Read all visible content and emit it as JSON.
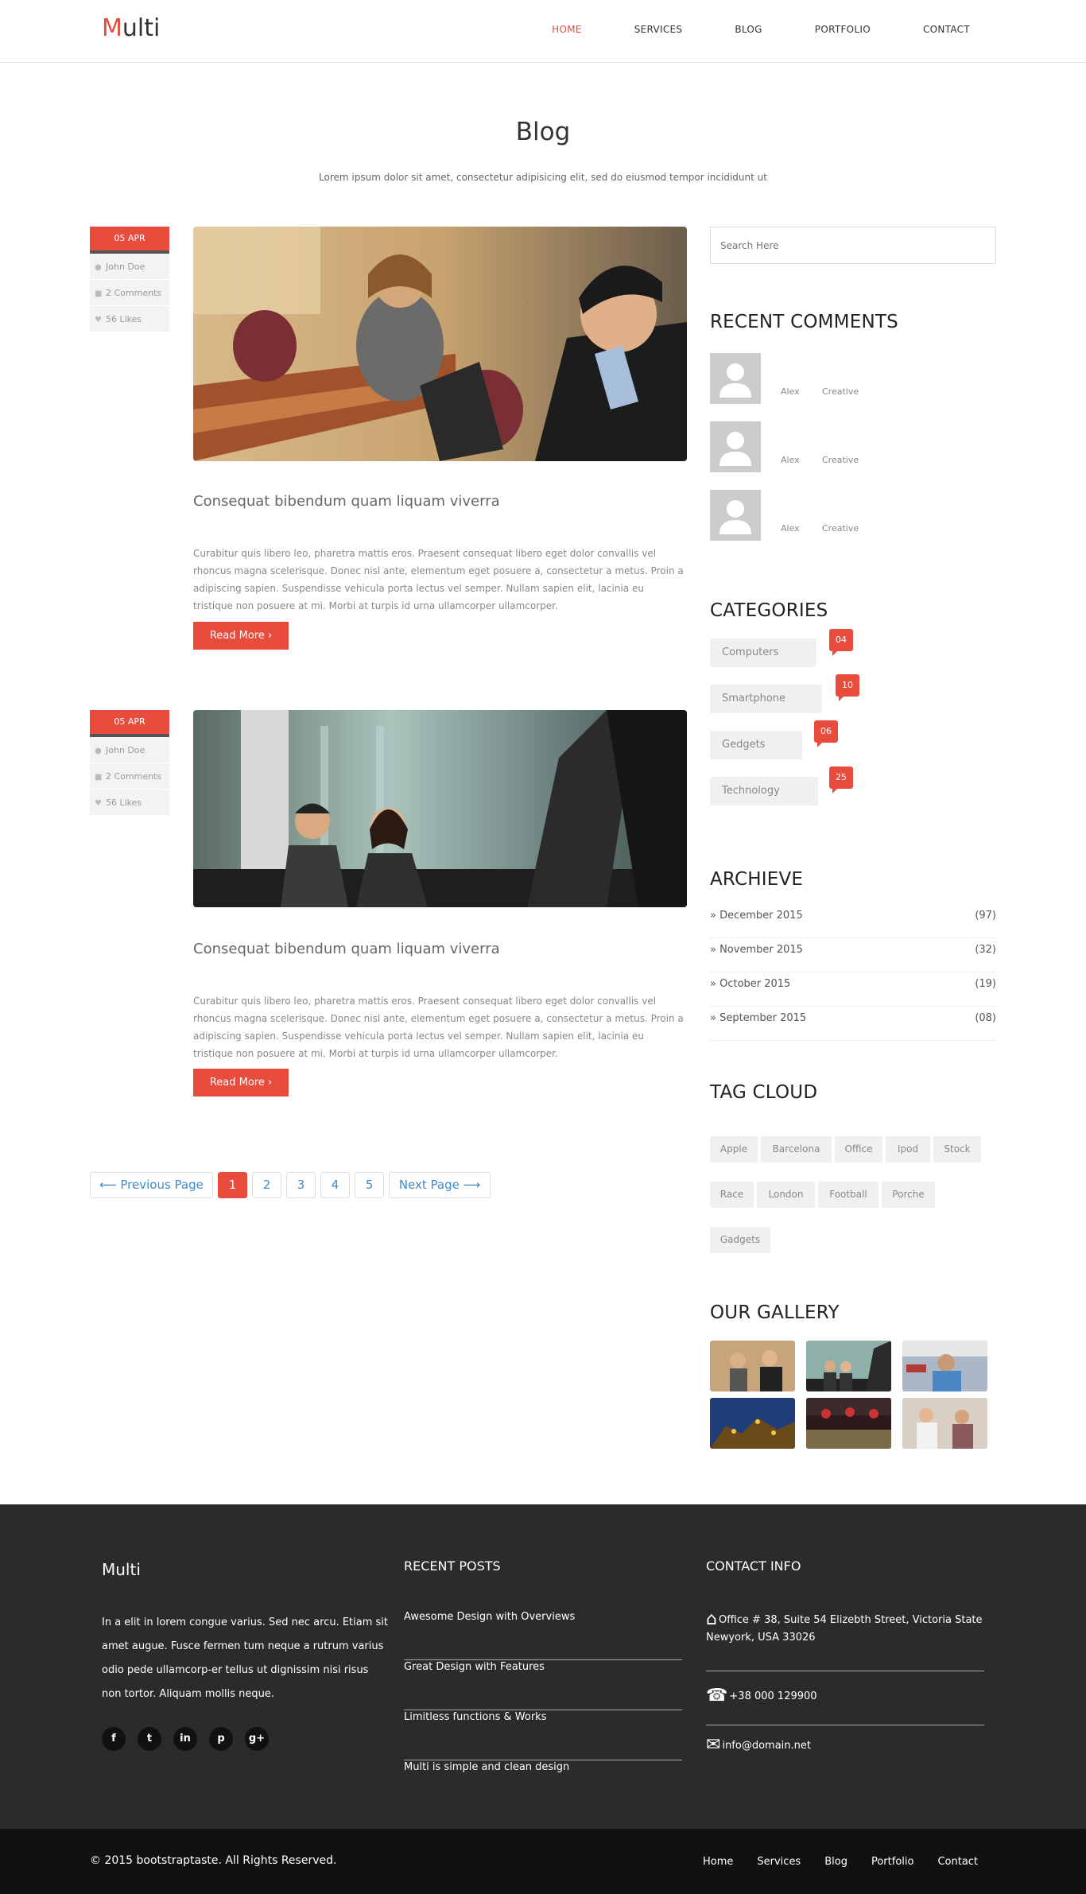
{
  "brand": {
    "first_letter": "M",
    "rest": "ulti"
  },
  "nav": [
    {
      "label": "HOME",
      "active": true
    },
    {
      "label": "SERVICES"
    },
    {
      "label": "BLOG"
    },
    {
      "label": "PORTFOLIO"
    },
    {
      "label": "CONTACT"
    }
  ],
  "page": {
    "title": "Blog",
    "subtitle": "Lorem ipsum dolor sit amet, consectetur adipisicing elit, sed do eiusmod tempor incididunt ut"
  },
  "posts": [
    {
      "date": "05 APR",
      "author": "John Doe",
      "comments": "2 Comments",
      "likes": "56 Likes",
      "title": "Consequat bibendum quam liquam viverra",
      "body": "Curabitur quis libero leo, pharetra mattis eros. Praesent consequat libero eget dolor convallis vel rhoncus magna scelerisque. Donec nisl ante, elementum eget posuere a, consectetur a metus. Proin a adipiscing sapien. Suspendisse vehicula porta lectus vel semper. Nullam sapien elit, lacinia eu tristique non posuere at mi. Morbi at turpis id urna ullamcorper ullamcorper.",
      "read_more": "Read More ›"
    },
    {
      "date": "05 APR",
      "author": "John Doe",
      "comments": "2 Comments",
      "likes": "56 Likes",
      "title": "Consequat bibendum quam liquam viverra",
      "body": "Curabitur quis libero leo, pharetra mattis eros. Praesent consequat libero eget dolor convallis vel rhoncus magna scelerisque. Donec nisl ante, elementum eget posuere a, consectetur a metus. Proin a adipiscing sapien. Suspendisse vehicula porta lectus vel semper. Nullam sapien elit, lacinia eu tristique non posuere at mi. Morbi at turpis id urna ullamcorper ullamcorper.",
      "read_more": "Read More ›"
    }
  ],
  "pagination": {
    "prev": "⟵ Previous Page",
    "pages": [
      "1",
      "2",
      "3",
      "4",
      "5"
    ],
    "current": "1",
    "next": "Next Page ⟶"
  },
  "sidebar": {
    "search_placeholder": "Search Here",
    "recent_comments_title": "RECENT COMMENTS",
    "recent_comments": [
      {
        "name": "Alex",
        "text": "Creative"
      },
      {
        "name": "Alex",
        "text": "Creative"
      },
      {
        "name": "Alex",
        "text": "Creative"
      }
    ],
    "categories_title": "CATEGORIES",
    "categories": [
      {
        "label": "Computers",
        "count": "04"
      },
      {
        "label": "Smartphone",
        "count": "10"
      },
      {
        "label": "Gedgets",
        "count": "06"
      },
      {
        "label": "Technology",
        "count": "25"
      }
    ],
    "archive_title": "ARCHIEVE",
    "archive": [
      {
        "label": "» December 2015",
        "count": "(97)"
      },
      {
        "label": "» November 2015",
        "count": "(32)"
      },
      {
        "label": "» October 2015",
        "count": "(19)"
      },
      {
        "label": "» September 2015",
        "count": "(08)"
      }
    ],
    "tag_cloud_title": "TAG CLOUD",
    "tags": [
      "Apple",
      "Barcelona",
      "Office",
      "Ipod",
      "Stock",
      "Race",
      "London",
      "Football",
      "Porche",
      "Gadgets"
    ],
    "gallery_title": "OUR GALLERY"
  },
  "footer": {
    "brand": "Multi",
    "about": "In a elit in lorem congue varius. Sed nec arcu. Etiam sit amet augue. Fusce fermen tum neque a rutrum varius odio pede ullamcorp-er tellus ut dignissim nisi risus non tortor. Aliquam mollis neque.",
    "socials": [
      {
        "icon": "facebook-icon",
        "glyph": "f"
      },
      {
        "icon": "twitter-icon",
        "glyph": "t"
      },
      {
        "icon": "linkedin-icon",
        "glyph": "in"
      },
      {
        "icon": "pinterest-icon",
        "glyph": "p"
      },
      {
        "icon": "google-plus-icon",
        "glyph": "g+"
      }
    ],
    "recent_posts_title": "RECENT POSTS",
    "recent_posts": [
      "Awesome Design with Overviews",
      "Great Design with Features",
      "Limitless functions & Works",
      "Multi is simple and clean design"
    ],
    "contact_title": "CONTACT INFO",
    "address": "Office # 38, Suite 54 Elizebth Street, Victoria State Newyork, USA 33026",
    "phone": "+38 000 129900",
    "email": "info@domain.net"
  },
  "copyright": {
    "text": "© 2015 bootstraptaste. All Rights Reserved.",
    "links": [
      "Home",
      "Services",
      "Blog",
      "Portfolio",
      "Contact"
    ]
  },
  "colors": {
    "accent": "#e84c3d",
    "footer_bg": "#2b2b2b",
    "copyright_bg": "#111111"
  }
}
